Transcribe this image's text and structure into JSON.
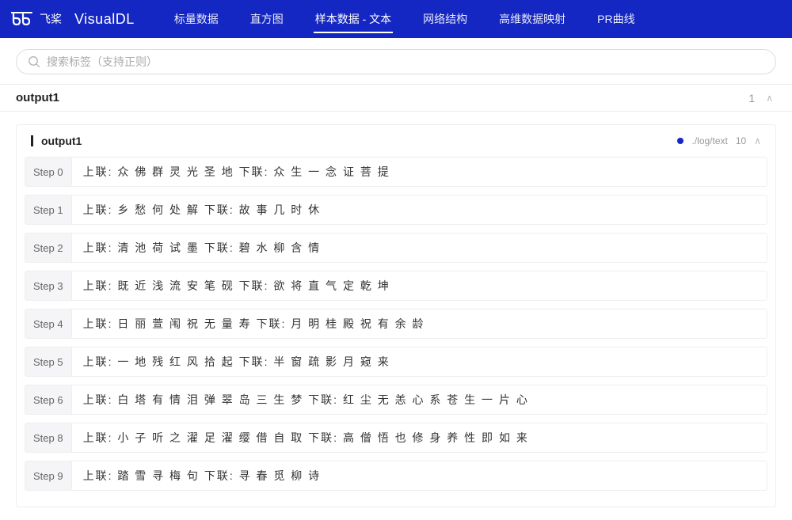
{
  "header": {
    "logo_text": "飞桨",
    "app_name": "VisualDL",
    "nav": [
      {
        "label": "标量数据",
        "active": false
      },
      {
        "label": "直方图",
        "active": false
      },
      {
        "label": "样本数据 - 文本",
        "active": true
      },
      {
        "label": "网络结构",
        "active": false
      },
      {
        "label": "高维数据映射",
        "active": false
      },
      {
        "label": "PR曲线",
        "active": false
      }
    ]
  },
  "search": {
    "placeholder": "搜索标签（支持正则）"
  },
  "section": {
    "title": "output1",
    "count": "1",
    "chevron": "∧"
  },
  "panel": {
    "title": "output1",
    "source": "./log/text",
    "count": "10",
    "chevron": "∧",
    "steps": [
      {
        "label": "Step 0",
        "text": "上联: 众 佛 群 灵 光 圣 地 下联: 众 生 一 念 证 菩 提"
      },
      {
        "label": "Step 1",
        "text": "上联: 乡 愁 何 处 解 下联: 故 事 几 时 休"
      },
      {
        "label": "Step 2",
        "text": "上联: 清 池 荷 试 墨 下联: 碧 水 柳 含 情"
      },
      {
        "label": "Step 3",
        "text": "上联: 既 近 浅 流 安 笔 砚 下联: 欲 将 直 气 定 乾 坤"
      },
      {
        "label": "Step 4",
        "text": "上联: 日 丽 萱 闱 祝 无 量 寿 下联: 月 明 桂 殿 祝 有 余 龄"
      },
      {
        "label": "Step 5",
        "text": "上联: 一 地 残 红 风 拾 起 下联: 半 窗 疏 影 月 窥 来"
      },
      {
        "label": "Step 6",
        "text": "上联: 白 塔 有 情 泪 弹 翠 岛 三 生 梦 下联: 红 尘 无 恙 心 系 苍 生 一 片 心"
      },
      {
        "label": "Step 8",
        "text": "上联: 小 子 听 之 濯 足 濯 缨 借 自 取 下联: 高 僧 悟 也 修 身 养 性 即 如 来"
      },
      {
        "label": "Step 9",
        "text": "上联: 踏 雪 寻 梅 句 下联: 寻 春 觅 柳 诗"
      }
    ]
  }
}
